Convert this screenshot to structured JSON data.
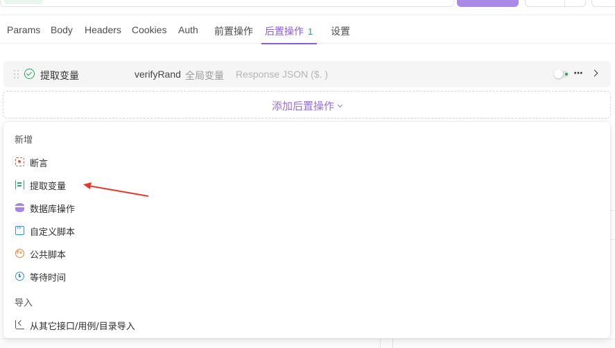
{
  "tabs": [
    {
      "label": "Params"
    },
    {
      "label": "Body"
    },
    {
      "label": "Headers"
    },
    {
      "label": "Cookies"
    },
    {
      "label": "Auth"
    },
    {
      "label": "前置操作"
    },
    {
      "label": "后置操作",
      "badge": "1",
      "active": true
    },
    {
      "label": "设置"
    }
  ],
  "post_op_row": {
    "label": "提取变量",
    "variable": "verifyRand",
    "scope": "全局变量",
    "expression": "Response JSON ($. )",
    "enabled": true
  },
  "add_post_op": {
    "label": "添加后置操作"
  },
  "menu": {
    "groups": [
      {
        "title": "新增",
        "items": [
          {
            "label": "断言",
            "icon": "assert-icon"
          },
          {
            "label": "提取变量",
            "icon": "extract-variable-icon"
          },
          {
            "label": "数据库操作",
            "icon": "database-icon"
          },
          {
            "label": "自定义脚本",
            "icon": "script-icon"
          },
          {
            "label": "公共脚本",
            "icon": "public-script-icon"
          },
          {
            "label": "等待时间",
            "icon": "clock-icon"
          }
        ]
      },
      {
        "title": "导入",
        "items": [
          {
            "label": "从其它接口/用例/目录导入",
            "icon": "import-icon"
          }
        ]
      }
    ]
  },
  "colors": {
    "accent": "#8b5cd6",
    "badge_green": "#27a25a",
    "annotation_red": "#e03a2f"
  }
}
